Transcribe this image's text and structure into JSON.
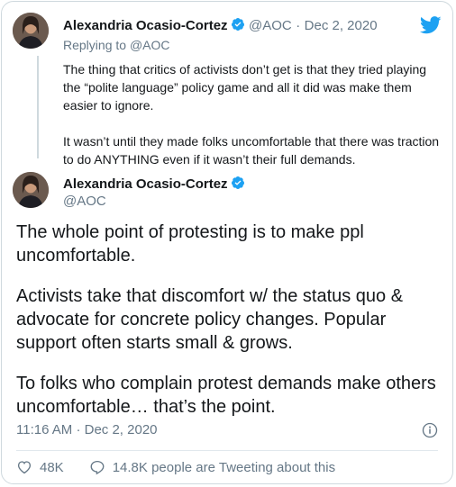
{
  "reply_tweet": {
    "author_name": "Alexandria Ocasio-Cortez",
    "author_handle": "@AOC",
    "separator": "·",
    "date": "Dec 2, 2020",
    "replying_prefix": "Replying to",
    "replying_handle": "@AOC",
    "paragraphs": [
      "The thing that critics of activists don’t get is that they tried playing the “polite language” policy game and all it did was make them easier to ignore.",
      "It wasn’t until they made folks uncomfortable that there was traction to do ANYTHING even if it wasn’t their full demands."
    ]
  },
  "main_tweet": {
    "author_name": "Alexandria Ocasio-Cortez",
    "author_handle": "@AOC",
    "paragraphs": [
      "The whole point of protesting is to make ppl uncomfortable.",
      "Activists take that discomfort w/ the status quo & advocate for concrete policy changes. Popular support often starts small & grows.",
      "To folks who complain protest demands make others uncomfortable… that’s the point."
    ],
    "time": "11:16 AM",
    "separator": "·",
    "date": "Dec 2, 2020",
    "likes": "48K",
    "tweeting_about": "14.8K people are Tweeting about this"
  },
  "icons": {
    "brand": "twitter-bird-icon",
    "verified": "verified-badge-icon",
    "info": "info-icon",
    "like": "heart-icon",
    "conversation": "speech-bubble-icon"
  },
  "colors": {
    "brand_blue": "#1da1f2",
    "secondary_text": "#657786",
    "border": "#cfd9de"
  }
}
